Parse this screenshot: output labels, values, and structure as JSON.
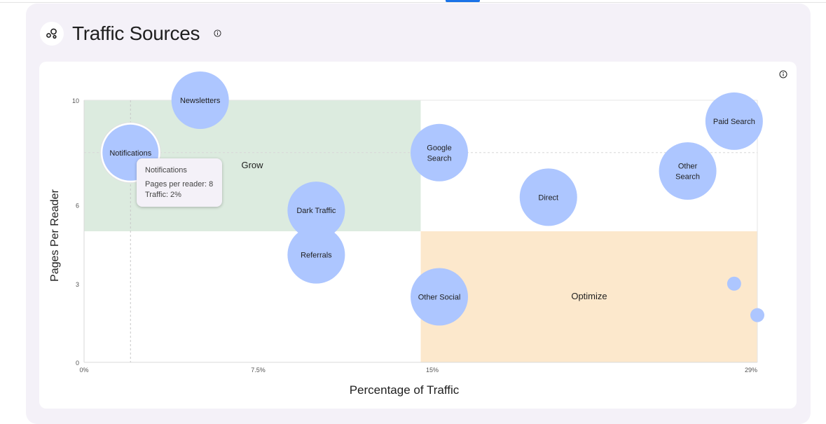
{
  "header": {
    "title": "Traffic Sources",
    "icon": "bubble-chart-icon"
  },
  "tooltip": {
    "title": "Notifications",
    "line1": "Pages per reader: 8",
    "line2": "Traffic: 2%"
  },
  "colors": {
    "bubble": "#adc6ff",
    "grow_zone": "#dcebdf",
    "optimize_zone": "#fce8cc",
    "accent": "#1a73e8"
  },
  "chart_data": {
    "type": "scatter",
    "title": "",
    "xlabel": "Percentage of Traffic",
    "ylabel": "Pages Per Reader",
    "xlim": [
      0,
      29
    ],
    "ylim": [
      0,
      10
    ],
    "x_ticks": [
      "0%",
      "7.5%",
      "15%",
      "29%"
    ],
    "x_tick_values": [
      0,
      7.5,
      15,
      29
    ],
    "y_ticks": [
      "0",
      "3",
      "6",
      "10"
    ],
    "y_tick_values": [
      0,
      3,
      6,
      10
    ],
    "quadrants": [
      {
        "label": "Grow",
        "x_range": [
          0,
          14.5
        ],
        "y_range": [
          5,
          10
        ]
      },
      {
        "label": "Optimize",
        "x_range": [
          14.5,
          29
        ],
        "y_range": [
          0,
          5
        ]
      }
    ],
    "highlight": {
      "name": "Notifications",
      "x": 2,
      "y": 8
    },
    "points": [
      {
        "name": "Newsletters",
        "label": [
          "Newsletters"
        ],
        "x": 5,
        "y": 10,
        "size": "large"
      },
      {
        "name": "Notifications",
        "label": [
          "Notifications"
        ],
        "x": 2,
        "y": 8,
        "size": "medium"
      },
      {
        "name": "Dark Traffic",
        "label": [
          "Dark Traffic"
        ],
        "x": 10,
        "y": 5.8,
        "size": "large"
      },
      {
        "name": "Referrals",
        "label": [
          "Referrals"
        ],
        "x": 10,
        "y": 4.1,
        "size": "large"
      },
      {
        "name": "Google Search",
        "label": [
          "Google",
          "Search"
        ],
        "x": 15.3,
        "y": 8,
        "size": "large"
      },
      {
        "name": "Other Social",
        "label": [
          "Other Social"
        ],
        "x": 15.3,
        "y": 2.5,
        "size": "large"
      },
      {
        "name": "Direct",
        "label": [
          "Direct"
        ],
        "x": 20,
        "y": 6.3,
        "size": "large"
      },
      {
        "name": "Other Search",
        "label": [
          "Other",
          "Search"
        ],
        "x": 26,
        "y": 7.3,
        "size": "large"
      },
      {
        "name": "Paid Search",
        "label": [
          "Paid Search"
        ],
        "x": 28,
        "y": 9.2,
        "size": "large"
      },
      {
        "name": "",
        "label": [],
        "x": 28,
        "y": 3,
        "size": "small"
      },
      {
        "name": "",
        "label": [],
        "x": 29,
        "y": 1.8,
        "size": "small"
      }
    ]
  }
}
